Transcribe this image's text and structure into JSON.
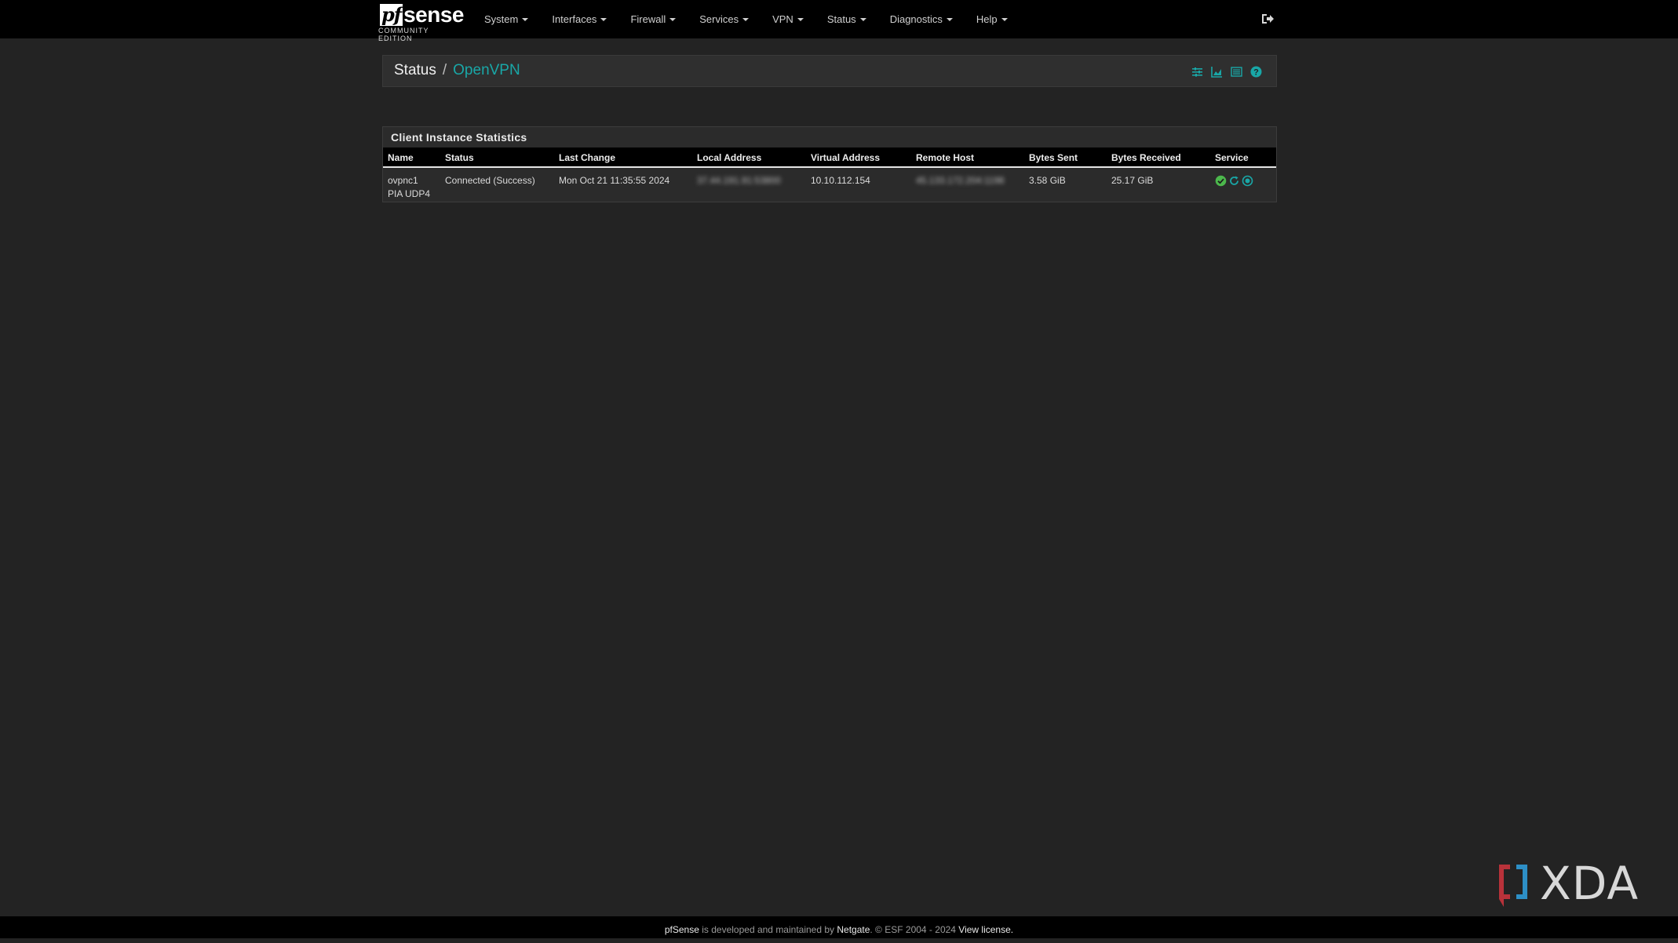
{
  "brand": {
    "pf": "pf",
    "sense": "sense",
    "edition": "COMMUNITY EDITION"
  },
  "nav": {
    "items": [
      {
        "label": "System"
      },
      {
        "label": "Interfaces"
      },
      {
        "label": "Firewall"
      },
      {
        "label": "Services"
      },
      {
        "label": "VPN"
      },
      {
        "label": "Status"
      },
      {
        "label": "Diagnostics"
      },
      {
        "label": "Help"
      }
    ],
    "logout_icon": "sign-out-icon"
  },
  "breadcrumb": {
    "section": "Status",
    "separator": "/",
    "page": "OpenVPN",
    "icons": [
      "sliders-icon",
      "area-chart-icon",
      "list-alt-icon",
      "question-circle-icon"
    ]
  },
  "panel": {
    "title": "Client Instance Statistics",
    "columns": [
      "Name",
      "Status",
      "Last Change",
      "Local Address",
      "Virtual Address",
      "Remote Host",
      "Bytes Sent",
      "Bytes Received",
      "Service"
    ],
    "rows": [
      {
        "name_line1": "ovpnc1",
        "name_line2": "PIA UDP4",
        "status": "Connected (Success)",
        "last_change": "Mon Oct 21 11:35:55 2024",
        "local_address": "37.44.191.91:53800",
        "virtual_address": "10.10.112.154",
        "remote_host": "45.133.172.204:1198",
        "bytes_sent": "3.58 GiB",
        "bytes_received": "25.17 GiB",
        "service_icons": [
          "check-circle-icon",
          "restart-icon",
          "stop-circle-icon"
        ]
      }
    ]
  },
  "colors": {
    "accent": "#19a7a7",
    "service_ok": "#4cb84c",
    "page_bg": "#232323",
    "navbar_bg": "#000000"
  },
  "footer": {
    "product": "pfSense",
    "middle": " is developed and maintained by ",
    "company": "Netgate",
    "copyright": ". © ESF 2004 - 2024 ",
    "license_link": "View license."
  },
  "watermark": {
    "text": "XDA"
  }
}
